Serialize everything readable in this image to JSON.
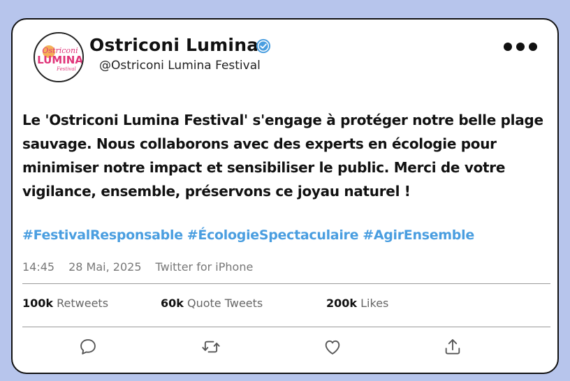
{
  "profile": {
    "display_name": "Ostriconi Lumina",
    "handle": "@Ostriconi Lumina Festival",
    "avatar_logo_text": [
      "Ostriconi",
      "LUMINA",
      "Festival"
    ]
  },
  "tweet": {
    "text": "Le 'Ostriconi Lumina Festival' s'engage à protéger notre belle plage sauvage. Nous collaborons avec des experts en écologie pour minimiser notre impact et sensibiliser le public. Merci de votre vigilance, ensemble, préservons ce joyau naturel !",
    "hashtags": [
      "#FestivalResponsable",
      "#ÉcologieSpectaculaire",
      "#AgirEnsemble"
    ]
  },
  "meta": {
    "time": "14:45",
    "date": "28 Mai, 2025",
    "source": "Twitter for iPhone"
  },
  "stats": {
    "retweets_count": "100k",
    "retweets_label": "Retweets",
    "quotes_count": "60k",
    "quotes_label": "Quote Tweets",
    "likes_count": "200k",
    "likes_label": "Likes"
  },
  "actions": [
    "reply-icon",
    "retweet-icon",
    "like-icon",
    "share-icon"
  ],
  "colors": {
    "background": "#b7c5ec",
    "hashtag": "#4a9ee0",
    "verified": "#4a9ee0",
    "logo_orange": "#f2a23a",
    "logo_pink": "#e0357a"
  }
}
